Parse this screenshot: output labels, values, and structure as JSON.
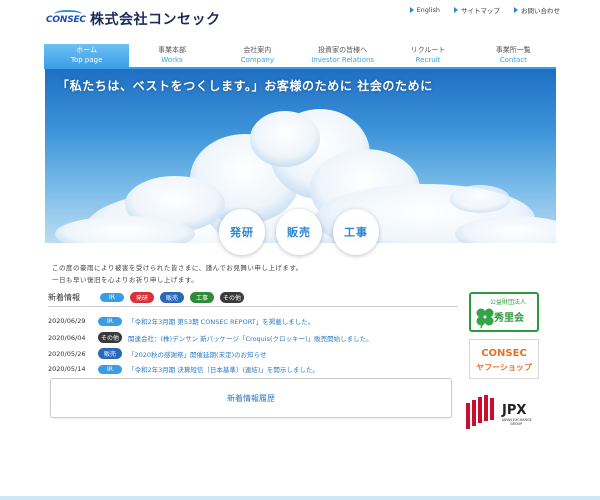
{
  "header": {
    "logo_word": "CONSEC",
    "company_name": "株式会社コンセック",
    "util_links": [
      "English",
      "サイトマップ",
      "お問い合わせ"
    ]
  },
  "nav": [
    {
      "ja": "ホーム",
      "en": "Top page",
      "active": true
    },
    {
      "ja": "事業本部",
      "en": "Works"
    },
    {
      "ja": "会社案内",
      "en": "Company"
    },
    {
      "ja": "投資家の皆様へ",
      "en": "Investor Relations"
    },
    {
      "ja": "リクルート",
      "en": "Recruit"
    },
    {
      "ja": "事業所一覧",
      "en": "Contact"
    }
  ],
  "hero": {
    "slogan": "「私たちは、ベストをつくします。」お客様のために 社会のために",
    "buttons": [
      "発研",
      "販売",
      "工事"
    ]
  },
  "notice": [
    "この度の豪雨により被害を受けられた皆さまに、謹んでお見舞い申し上げます。",
    "一日も早い復旧を心よりお祈り申し上げます。"
  ],
  "news": {
    "title": "新着情報",
    "filters": [
      {
        "label": "IR",
        "color": "#3a9de3"
      },
      {
        "label": "発研",
        "color": "#d9303a"
      },
      {
        "label": "販売",
        "color": "#2a67b8"
      },
      {
        "label": "工事",
        "color": "#2f8a3a"
      },
      {
        "label": "その他",
        "color": "#3a3a3a"
      }
    ],
    "items": [
      {
        "date": "2020/06/29",
        "tag": "IR",
        "tag_color": "#3a9de3",
        "text": "「令和2年3月期 第53期 CONSEC REPORT」を掲載しました。"
      },
      {
        "date": "2020/06/04",
        "tag": "その他",
        "tag_color": "#3a3a3a",
        "text": "関連会社：(株)デンサン 新パッケージ「Croquis(クロッキー)」販売開始しました。"
      },
      {
        "date": "2020/05/26",
        "tag": "販売",
        "tag_color": "#2a67b8",
        "text": "「2020秋の感謝祭」開催延期(未定)のお知らせ"
      },
      {
        "date": "2020/05/14",
        "tag": "IR",
        "tag_color": "#3a9de3",
        "text": "「令和2年3月期 決算短信〔日本基準〕(連結)」を開示しました。"
      }
    ],
    "history_label": "新着情報履歴"
  },
  "banners": {
    "shurikai_top": "公益財団法人",
    "shurikai_name": "秀里会",
    "shop_line1": "CONSEC",
    "shop_line2": "ヤフーショップ",
    "jpx_name": "JPX",
    "jpx_sub1": "JAPAN EXCHANGE",
    "jpx_sub2": "GROUP"
  },
  "colors": {
    "accent": "#3b9ee8",
    "link": "#2a7bc7",
    "green": "#2e9a3e",
    "jpx_red": "#c8102e"
  }
}
